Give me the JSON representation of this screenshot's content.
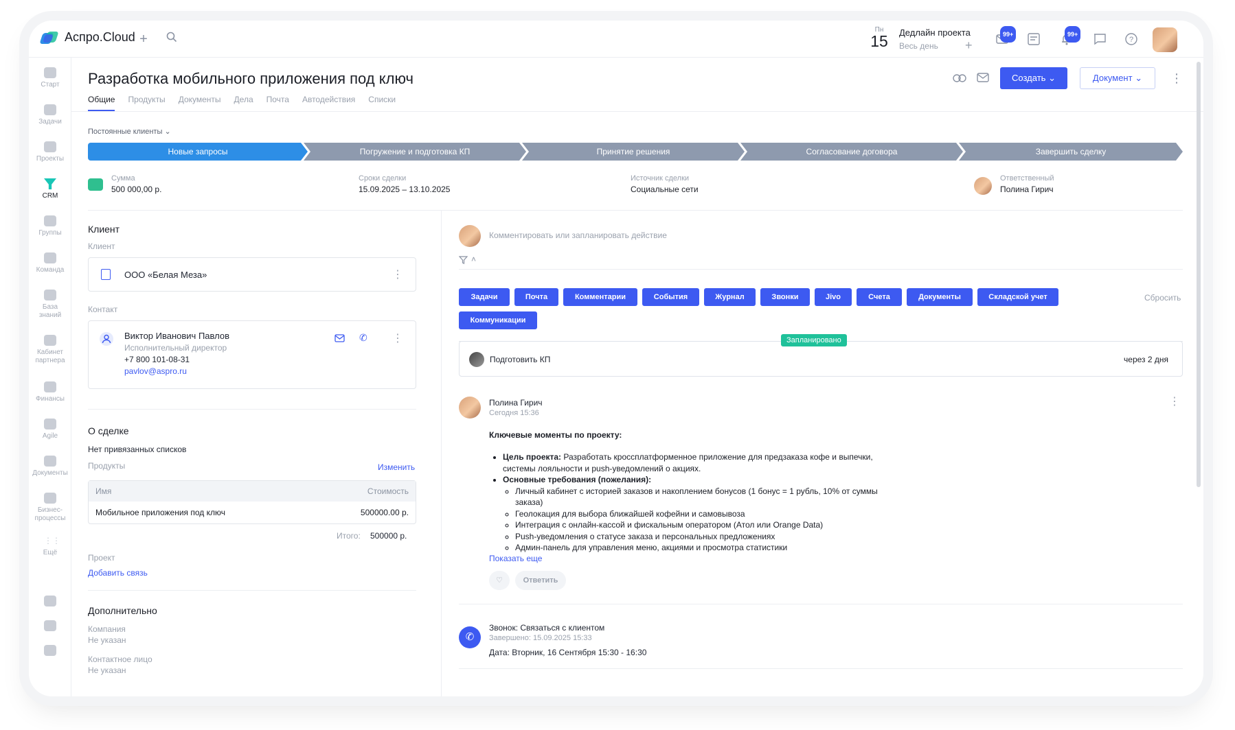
{
  "app": {
    "name": "Аспро.Cloud"
  },
  "topbar": {
    "date_dow": "Пн",
    "date_day": "15",
    "deadline_title": "Дедлайн проекта",
    "deadline_sub": "Весь день",
    "mail_badge": "99+",
    "bell_badge": "99+"
  },
  "rail": {
    "items": [
      {
        "label": "Старт"
      },
      {
        "label": "Задачи"
      },
      {
        "label": "Проекты"
      },
      {
        "label": "CRM"
      },
      {
        "label": "Группы"
      },
      {
        "label": "Команда"
      },
      {
        "label": "База знаний"
      },
      {
        "label": "Кабинет партнера"
      },
      {
        "label": "Финансы"
      },
      {
        "label": "Agile"
      },
      {
        "label": "Документы"
      },
      {
        "label": "Бизнес-процессы"
      },
      {
        "label": "Ещё"
      }
    ]
  },
  "page": {
    "title": "Разработка мобильного приложения под ключ",
    "tabs": [
      "Общие",
      "Продукты",
      "Документы",
      "Дела",
      "Почта",
      "Автодействия",
      "Списки"
    ],
    "create_label": "Создать",
    "document_label": "Документ"
  },
  "pipeline": {
    "label": "Постоянные клиенты",
    "stages": [
      {
        "name": "Новые запросы",
        "color": "#2d8ee6"
      },
      {
        "name": "Погружение и подготовка КП",
        "color": "#8e9aae"
      },
      {
        "name": "Принятие решения",
        "color": "#8e9aae"
      },
      {
        "name": "Согласование договора",
        "color": "#8e9aae"
      },
      {
        "name": "Завершить сделку",
        "color": "#8e9aae"
      }
    ]
  },
  "deal": {
    "sum_label": "Сумма",
    "sum_value": "500 000,00 р.",
    "dates_label": "Сроки сделки",
    "dates_value": "15.09.2025  –  13.10.2025",
    "source_label": "Источник сделки",
    "source_value": "Социальные сети",
    "resp_label": "Ответственный",
    "resp_value": "Полина Гирич"
  },
  "client": {
    "section_title": "Клиент",
    "client_label": "Клиент",
    "company": "ООО «Белая Меза»",
    "contact_label": "Контакт",
    "contact_name": "Виктор Иванович Павлов",
    "contact_role": "Исполнительный директор",
    "contact_phone": "+7 800 101-08-31",
    "contact_email": "pavlov@aspro.ru"
  },
  "about": {
    "section_title": "О сделке",
    "no_lists": "Нет привязанных списков",
    "products_label": "Продукты",
    "edit_label": "Изменить",
    "col_name": "Имя",
    "col_cost": "Стоимость",
    "product_name": "Мобильное приложения под ключ",
    "product_cost": "500000.00 р.",
    "total_label": "Итого:",
    "total_value": "500000 р.",
    "project_label": "Проект",
    "add_link": "Добавить связь"
  },
  "extra": {
    "section_title": "Дополнительно",
    "company_label": "Компания",
    "company_value": "Не указан",
    "contact_label": "Контактное лицо",
    "contact_value": "Не указан"
  },
  "feed": {
    "comment_placeholder": "Комментировать или запланировать действие",
    "filters_row1": [
      "Задачи",
      "Почта",
      "Комментарии",
      "События",
      "Журнал",
      "Звонки",
      "Jivo",
      "Счета",
      "Документы",
      "Складской учет"
    ],
    "filters_row2": [
      "Коммуникации"
    ],
    "reset_label": "Сбросить",
    "planned_tag": "Запланировано",
    "planned_task": "Подготовить КП",
    "planned_due": "через 2 дня",
    "post_author": "Полина Гирич",
    "post_time": "Сегодня 15:36",
    "post_heading": "Ключевые моменты по проекту:",
    "goal_label": "Цель проекта:",
    "goal_text": " Разработать кроссплатформенное приложение для предзаказа кофе и выпечки, системы лояльности и push-уведомлений о акциях.",
    "req_label": "Основные требования (пожелания):",
    "requirements": [
      "Личный кабинет с историей заказов и накоплением бонусов (1 бонус = 1 рубль, 10% от суммы заказа)",
      "Геолокация для выбора ближайшей кофейни и самовывоза",
      "Интеграция с онлайн-кассой и фискальным оператором (Атол или Orange Data)",
      "Push-уведомления о статусе заказа и персональных предложениях",
      "Админ-панель для управления меню, акциями и просмотра статистики"
    ],
    "show_more": "Показать еще",
    "reply_label": "Ответить",
    "call_title": "Звонок: Связаться с клиентом",
    "call_done": "Завершено: 15.09.2025 15:33",
    "call_date": "Дата: Вторник, 16 Сентября 15:30 - 16:30"
  },
  "colors": {
    "accent": "#3d5af1",
    "stage_active": "#2d8ee6",
    "stage_idle": "#8e9aae",
    "planned": "#1fc19a"
  }
}
